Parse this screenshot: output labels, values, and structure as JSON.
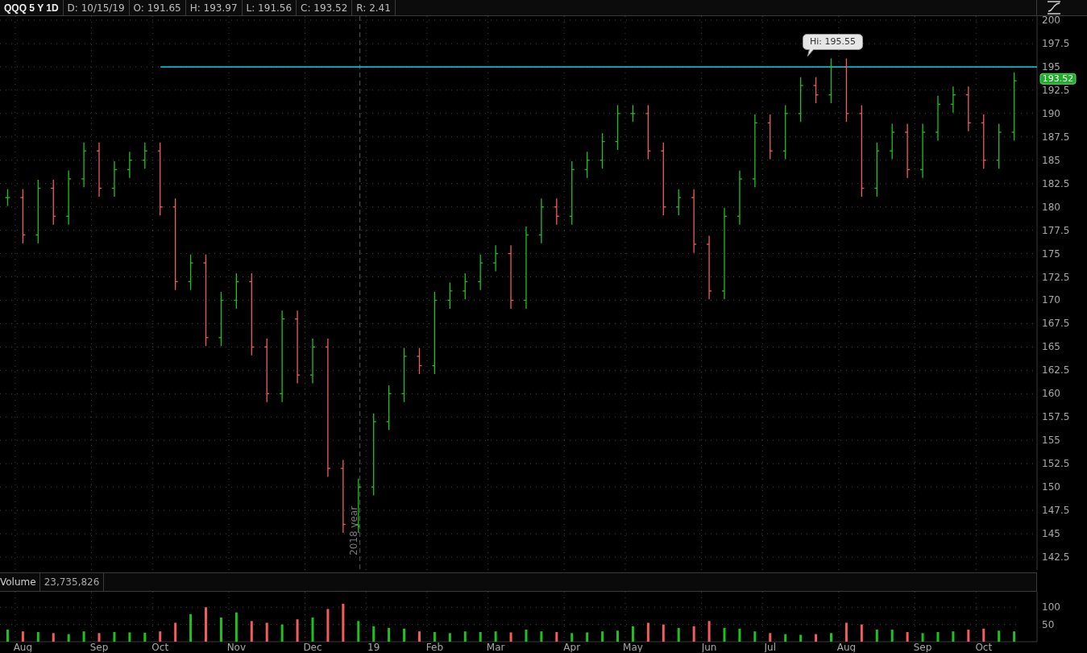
{
  "header": {
    "symbol": "QQQ 5 Y 1D",
    "fields": [
      "D: 10/15/19",
      "O: 191.65",
      "H: 193.97",
      "L: 191.56",
      "C: 193.52",
      "R: 2.41"
    ]
  },
  "price_chart": {
    "last_price": "193.52",
    "high_label": "Hi: 195.55",
    "year_label": "2018 year",
    "axis_labels": [
      "200",
      "197.5",
      "195",
      "192.5",
      "190",
      "187.5",
      "185",
      "182.5",
      "180",
      "177.5",
      "175",
      "172.5",
      "170",
      "167.5",
      "165",
      "162.5",
      "160",
      "157.5",
      "155",
      "152.5",
      "150",
      "147.5",
      "145",
      "142.5"
    ]
  },
  "volume": {
    "value": "23,735,826",
    "chart_data": {
      "type": "bar",
      "grid": true,
      "ylim": [
        0,
        145
      ],
      "yticks": [
        50,
        100
      ],
      "categories": [
        null,
        "Aug",
        null,
        null,
        null,
        null,
        "Sep",
        null,
        null,
        null,
        "Oct",
        null,
        null,
        null,
        null,
        "Nov",
        null,
        null,
        null,
        null,
        "Dec",
        null,
        null,
        null,
        "19",
        null,
        null,
        null,
        "Feb",
        null,
        null,
        null,
        "Mar",
        null,
        null,
        null,
        null,
        "Apr",
        null,
        null,
        null,
        "May",
        null,
        null,
        null,
        null,
        "Jun",
        null,
        null,
        null,
        "Jul",
        null,
        null,
        null,
        null,
        "Aug",
        null,
        null,
        null,
        null,
        "Sep",
        null,
        null,
        null,
        "Oct",
        null,
        null,
        null
      ],
      "series": [
        {
          "name": "Volume",
          "values": [
            35,
            30,
            28,
            25,
            22,
            30,
            25,
            28,
            27,
            26,
            30,
            55,
            80,
            100,
            70,
            85,
            60,
            55,
            50,
            65,
            70,
            95,
            110,
            60,
            45,
            40,
            38,
            30,
            28,
            25,
            30,
            28,
            30,
            27,
            35,
            30,
            28,
            25,
            27,
            30,
            32,
            45,
            55,
            50,
            40,
            45,
            60,
            40,
            38,
            30,
            25,
            22,
            20,
            22,
            25,
            55,
            50,
            35,
            35,
            28,
            25,
            28,
            30,
            35,
            38,
            32,
            30,
            null
          ]
        }
      ]
    }
  }
}
